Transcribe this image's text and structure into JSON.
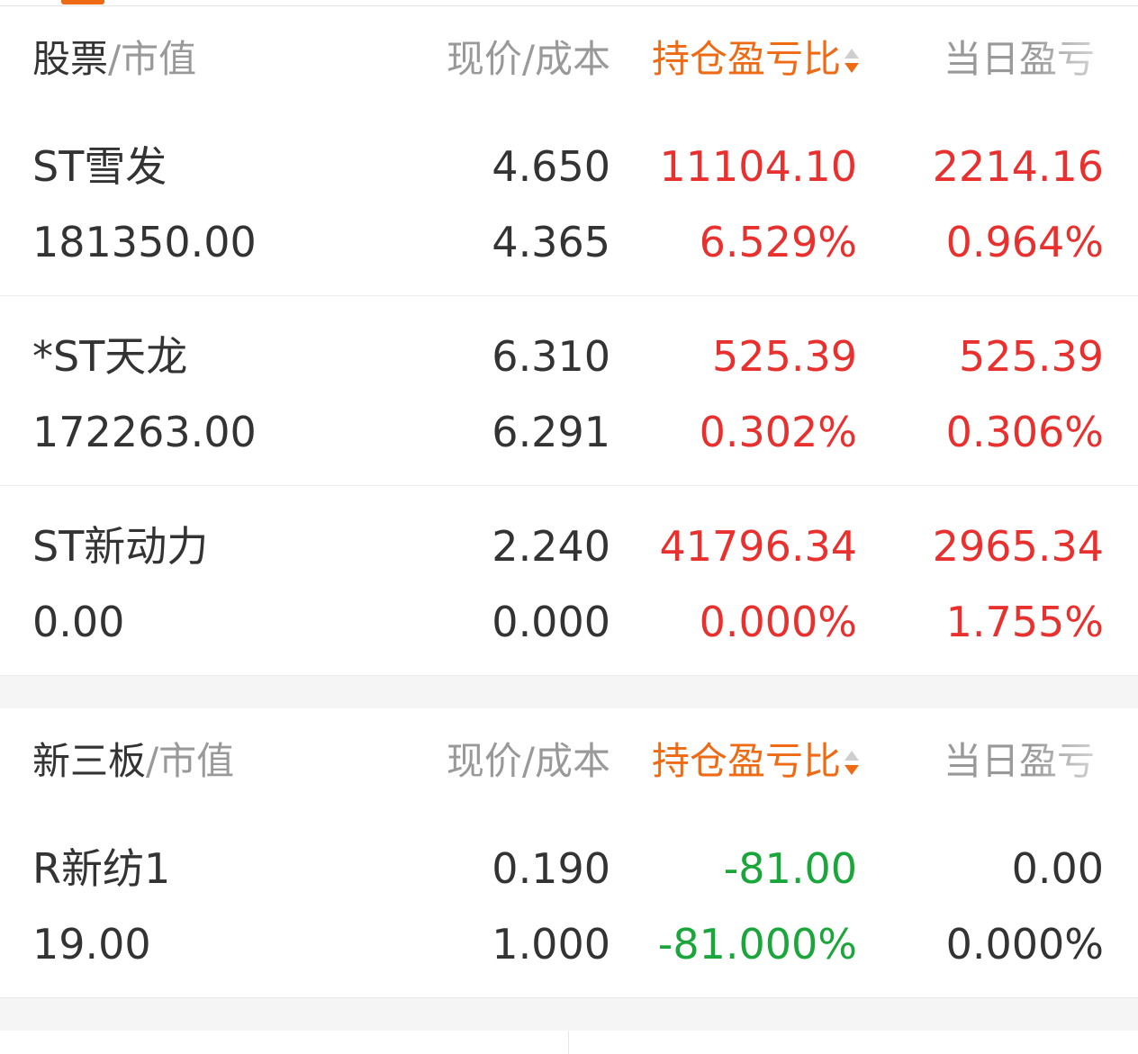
{
  "colors": {
    "accent": "#ee6a14",
    "gain": "#e8302e",
    "loss": "#1aa63a",
    "text": "#333333",
    "muted": "#999999"
  },
  "stocks_section": {
    "header": {
      "name": "股票",
      "sep_value": "/市值",
      "price_cost": "现价/成本",
      "pl_ratio": "持仓盈亏比",
      "today_pl": "当日盈亏"
    },
    "rows": [
      {
        "name": "ST雪发",
        "market_value": "181350.00",
        "price": "4.650",
        "cost": "4.365",
        "pl": "11104.10",
        "pl_pct": "6.529%",
        "today": "2214.16",
        "today_pct": "0.964%"
      },
      {
        "name": "*ST天龙",
        "market_value": "172263.00",
        "price": "6.310",
        "cost": "6.291",
        "pl": "525.39",
        "pl_pct": "0.302%",
        "today": "525.39",
        "today_pct": "0.306%"
      },
      {
        "name": "ST新动力",
        "market_value": "0.00",
        "price": "2.240",
        "cost": "0.000",
        "pl": "41796.34",
        "pl_pct": "0.000%",
        "today": "2965.34",
        "today_pct": "1.755%"
      }
    ]
  },
  "neeq_section": {
    "header": {
      "name": "新三板",
      "sep_value": "/市值",
      "price_cost": "现价/成本",
      "pl_ratio": "持仓盈亏比",
      "today_pl": "当日盈亏"
    },
    "rows": [
      {
        "name": "R新纺1",
        "market_value": "19.00",
        "price": "0.190",
        "cost": "1.000",
        "pl": "-81.00",
        "pl_pct": "-81.000%",
        "today": "0.00",
        "today_pct": "0.000%"
      }
    ]
  },
  "icons": {
    "sort": "sort-arrows-icon"
  }
}
